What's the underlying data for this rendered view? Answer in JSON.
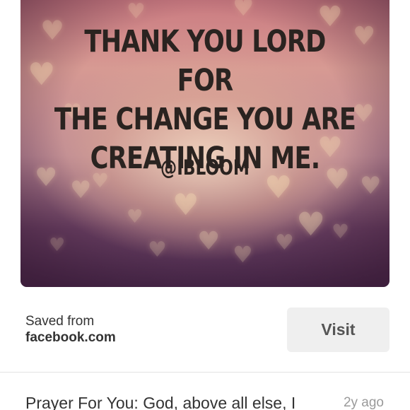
{
  "pin": {
    "image_text": {
      "lines": [
        "THANK YOU LORD FOR",
        "THE CHANGE YOU ARE",
        "CREATING IN ME."
      ],
      "handle": "@IBLOOM"
    },
    "decoration_icon": "heart-icon"
  },
  "source": {
    "saved_from_label": "Saved from",
    "domain": "facebook.com",
    "visit_label": "Visit"
  },
  "description": {
    "text": "Prayer For You: God, above all else, I",
    "timestamp": "2y ago"
  }
}
